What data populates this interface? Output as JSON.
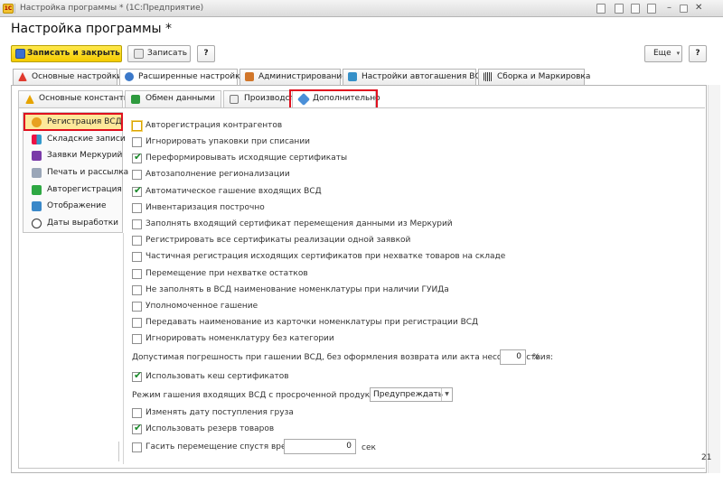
{
  "window": {
    "title": "Настройка программы * (1С:Предприятие)",
    "logo_text": "1С"
  },
  "header": {
    "title": "Настройка программы *"
  },
  "toolbar": {
    "save_close": "Записать и закрыть",
    "save": "Записать",
    "help": "?",
    "more": "Еще",
    "more_arrow": "▾"
  },
  "tabs": [
    {
      "label": "Основные настройки",
      "icon": "warning-icon"
    },
    {
      "label": "Расширенные настройки",
      "icon": "gear-icon"
    },
    {
      "label": "Администрирование",
      "icon": "tools-icon"
    },
    {
      "label": "Настройки автогашения ВСД",
      "icon": "settings-icon"
    },
    {
      "label": "Сборка и Маркировка",
      "icon": "barcode-icon"
    }
  ],
  "subtabs": [
    {
      "label": "Основные константы",
      "icon": "warning-icon"
    },
    {
      "label": "Обмен данными",
      "icon": "exchange-icon"
    },
    {
      "label": "Производство",
      "icon": "document-icon"
    },
    {
      "label": "Дополнительно",
      "icon": "wrench-icon"
    }
  ],
  "nav": [
    {
      "label": "Регистрация ВСД"
    },
    {
      "label": "Складские записи"
    },
    {
      "label": "Заявки Меркурий"
    },
    {
      "label": "Печать и рассылка"
    },
    {
      "label": "Авторегистрация"
    },
    {
      "label": "Отображение"
    },
    {
      "label": "Даты выработки"
    }
  ],
  "options": [
    {
      "label": "Авторегистрация контрагентов",
      "checked": false
    },
    {
      "label": "Игнорировать упаковки при списании",
      "checked": false
    },
    {
      "label": "Переформировывать исходящие сертификаты",
      "checked": true
    },
    {
      "label": "Автозаполнение регионализации",
      "checked": false
    },
    {
      "label": "Автоматическое гашение входящих ВСД",
      "checked": true
    },
    {
      "label": "Инвентаризация построчно",
      "checked": false
    },
    {
      "label": "Заполнять входящий сертификат перемещения данными из Меркурий",
      "checked": false
    },
    {
      "label": "Регистрировать все сертификаты реализации одной заявкой",
      "checked": false
    },
    {
      "label": "Частичная регистрация исходящих сертификатов при нехватке товаров на складе",
      "checked": false
    },
    {
      "label": "Перемещение при нехватке остатков",
      "checked": false
    },
    {
      "label": "Не заполнять в ВСД наименование номенклатуры при наличии ГУИДа",
      "checked": false
    },
    {
      "label": "Уполномоченное гашение",
      "checked": false
    },
    {
      "label": "Передавать наименование из карточки номенклатуры при регистрации ВСД",
      "checked": false
    },
    {
      "label": "Игнорировать номенклатуру без категории",
      "checked": false
    }
  ],
  "tolerance": {
    "label": "Допустимая погрешность при гашении ВСД, без оформления возврата или акта несоответствия:",
    "value": "0",
    "unit": "%"
  },
  "cache": {
    "label": "Использовать кеш сертификатов",
    "checked": true
  },
  "overdue": {
    "label": "Режим гашения входящих ВСД с просроченной продукцией:",
    "value": "Предупреждать"
  },
  "change_date": {
    "label": "Изменять дату поступления груза",
    "checked": false
  },
  "reserve": {
    "label": "Использовать резерв товаров",
    "checked": true
  },
  "extinguish": {
    "label": "Гасить перемещение спустя время",
    "value": "0",
    "unit": "сек",
    "checked": false
  },
  "page_counter": "21"
}
